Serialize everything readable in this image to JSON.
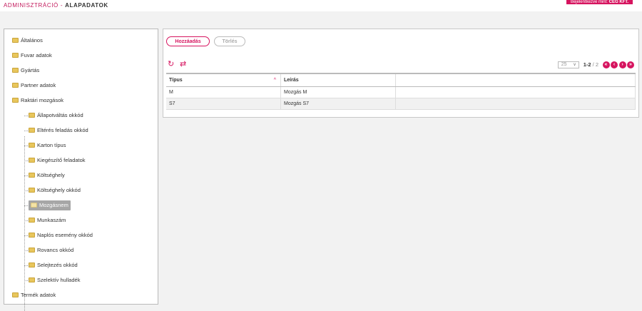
{
  "header": {
    "breadcrumb_root": "ADMINISZTRÁCIÓ",
    "breadcrumb_sep": "-",
    "breadcrumb_current": "ALAPADATOK",
    "user_label": "Bejelentkezve mint:",
    "user_name": "CÉG KFT."
  },
  "tree": {
    "items": [
      {
        "label": "Általános"
      },
      {
        "label": "Fuvar adatok"
      },
      {
        "label": "Gyártás"
      },
      {
        "label": "Partner adatok"
      },
      {
        "label": "Raktári mozgások"
      },
      {
        "label": "Állapotváltás okkód"
      },
      {
        "label": "Eltérés feladás okkód"
      },
      {
        "label": "Karton típus"
      },
      {
        "label": "Kiegészítő feladatok"
      },
      {
        "label": "Költséghely"
      },
      {
        "label": "Költséghely okkód"
      },
      {
        "label": "Mozgásnem",
        "selected": true
      },
      {
        "label": "Munkaszám"
      },
      {
        "label": "Naplós esemény okkód"
      },
      {
        "label": "Rovancs okkód"
      },
      {
        "label": "Selejtezés okkód"
      },
      {
        "label": "Szelektív hulladék"
      },
      {
        "label": "Termék adatok"
      }
    ]
  },
  "toolbar": {
    "add_label": "Hozzáadás",
    "delete_label": "Törlés"
  },
  "icons": {
    "refresh": "refresh-icon",
    "swap": "swap-icon"
  },
  "pager": {
    "page_size": "25",
    "range": "1-2",
    "total": "/ 2"
  },
  "table": {
    "columns": [
      "Típus",
      "Leírás",
      ""
    ],
    "rows": [
      [
        "M",
        "Mozgás M",
        ""
      ],
      [
        "S7",
        "Mozgás S7",
        ""
      ]
    ]
  },
  "colors": {
    "accent": "#d6145f",
    "selected_bg": "#a6a6a6"
  }
}
